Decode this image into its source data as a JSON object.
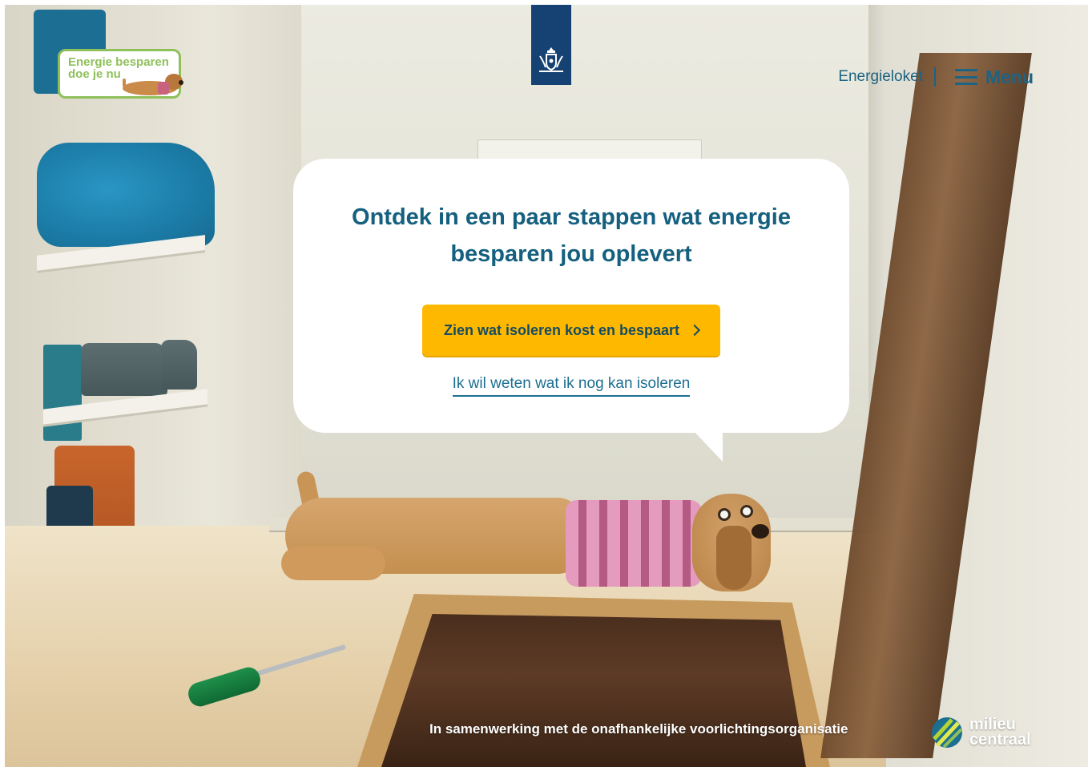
{
  "logo": {
    "line1": "Energie besparen",
    "line2": "doe je nu"
  },
  "emblem": {
    "icon": "coat-of-arms-icon",
    "color": "#154273"
  },
  "header": {
    "energieloket_label": "Energieloket",
    "menu_label": "Menu"
  },
  "bubble": {
    "headline": "Ontdek in een paar stappen wat energie besparen jou oplevert",
    "cta_label": "Zien wat isoleren kost en bespaart",
    "secondary_link": "Ik wil weten wat ik nog kan isoleren"
  },
  "footer": {
    "partner_text": "In samenwerking met de onafhankelijke voorlichtingsorganisatie",
    "partner_line1": "milieu",
    "partner_line2": "centraal"
  },
  "colors": {
    "brand_teal": "#15607f",
    "cta_yellow": "#ffb800",
    "logo_green": "#8fc05a",
    "rijksoverheid_blue": "#154273"
  }
}
